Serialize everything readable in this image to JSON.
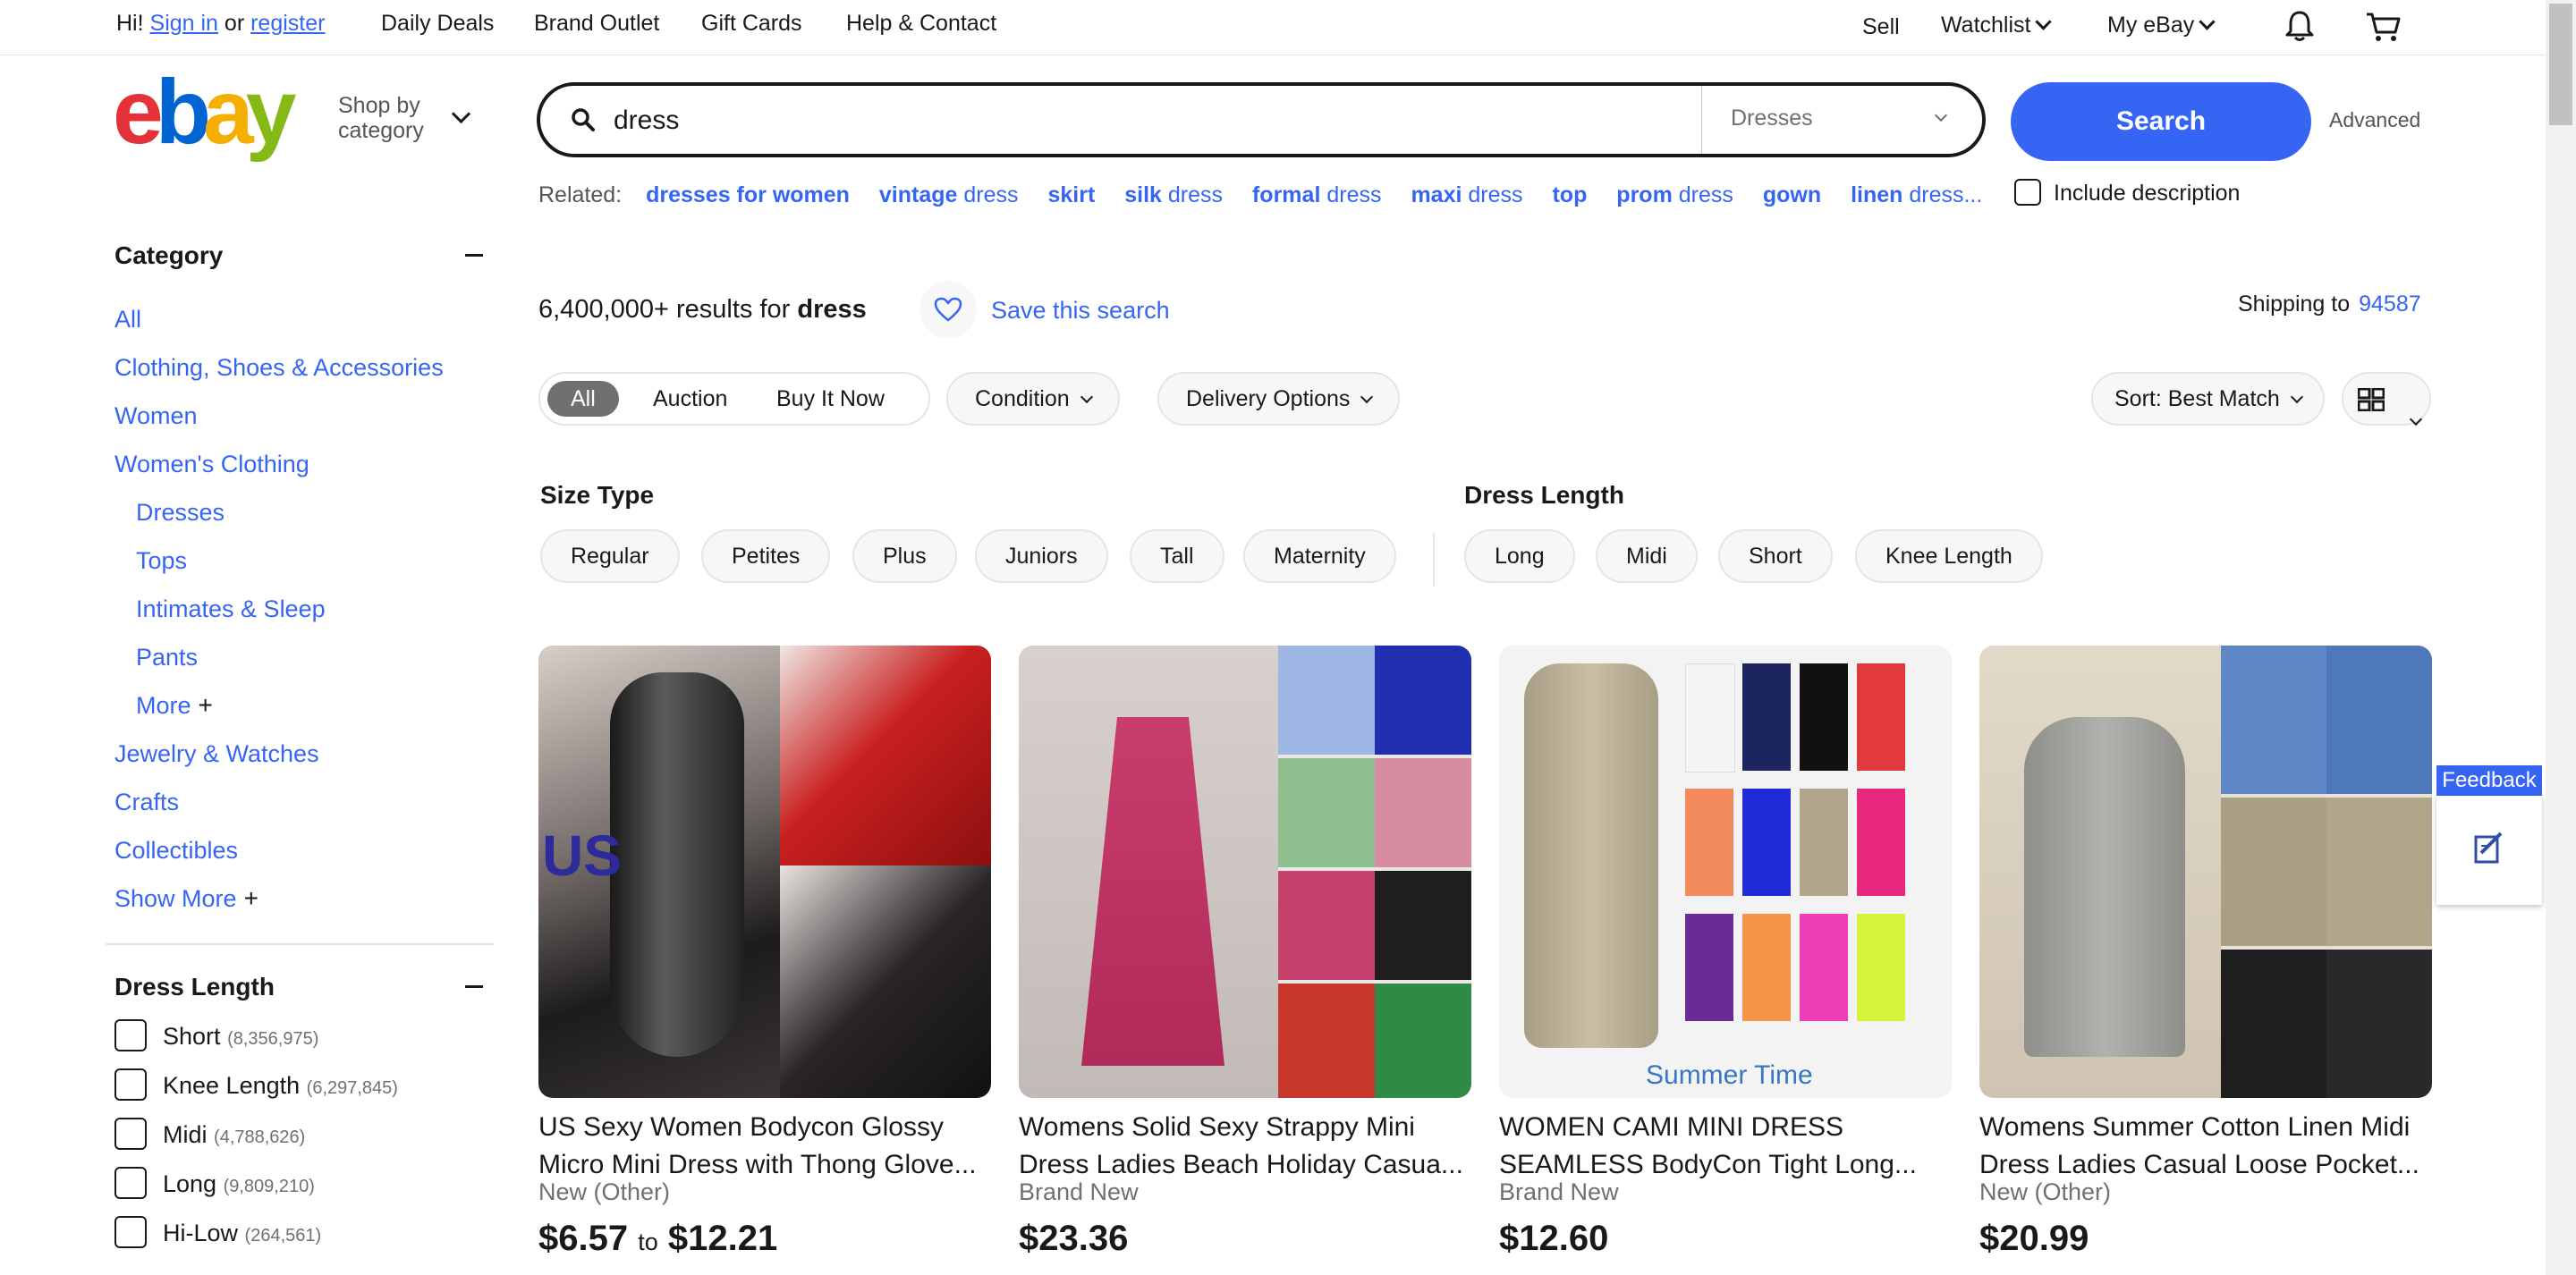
{
  "topbar": {
    "greeting": "Hi!",
    "sign_in": "Sign in",
    "or": "or",
    "register": "register",
    "nav": [
      "Daily Deals",
      "Brand Outlet",
      "Gift Cards",
      "Help & Contact"
    ],
    "sell": "Sell",
    "watchlist": "Watchlist",
    "my_ebay": "My eBay"
  },
  "header": {
    "logo_letters": [
      "e",
      "b",
      "a",
      "y"
    ],
    "logo_colors": [
      "#e53238",
      "#0064d2",
      "#f5af02",
      "#86b817"
    ],
    "shop_by_line1": "Shop by",
    "shop_by_line2": "category",
    "search_value": "dress",
    "category_select": "Dresses",
    "search_button": "Search",
    "advanced": "Advanced"
  },
  "related": {
    "label": "Related:",
    "items": [
      {
        "bold": "dresses for women",
        "rest": ""
      },
      {
        "bold": "vintage",
        "rest": " dress"
      },
      {
        "bold": "skirt",
        "rest": ""
      },
      {
        "bold": "silk",
        "rest": " dress"
      },
      {
        "bold": "formal",
        "rest": " dress"
      },
      {
        "bold": "maxi",
        "rest": " dress"
      },
      {
        "bold": "top",
        "rest": ""
      },
      {
        "bold": "prom",
        "rest": " dress"
      },
      {
        "bold": "gown",
        "rest": ""
      },
      {
        "bold": "linen",
        "rest": " dress..."
      }
    ],
    "include_description": "Include description"
  },
  "sidebar": {
    "category_heading": "Category",
    "categories": [
      {
        "label": "All",
        "indent": false
      },
      {
        "label": "Clothing, Shoes & Accessories",
        "indent": false
      },
      {
        "label": "Women",
        "indent": false
      },
      {
        "label": "Women's Clothing",
        "indent": false
      },
      {
        "label": "Dresses",
        "indent": true
      },
      {
        "label": "Tops",
        "indent": true
      },
      {
        "label": "Intimates & Sleep",
        "indent": true
      },
      {
        "label": "Pants",
        "indent": true
      },
      {
        "label": "More",
        "indent": true,
        "plus": true
      },
      {
        "label": "Jewelry & Watches",
        "indent": false
      },
      {
        "label": "Crafts",
        "indent": false
      },
      {
        "label": "Collectibles",
        "indent": false
      },
      {
        "label": "Show More",
        "indent": false,
        "plus": true
      }
    ],
    "dress_length_heading": "Dress Length",
    "dress_lengths": [
      {
        "label": "Short",
        "count": "(8,356,975)"
      },
      {
        "label": "Knee Length",
        "count": "(6,297,845)"
      },
      {
        "label": "Midi",
        "count": "(4,788,626)"
      },
      {
        "label": "Long",
        "count": "(9,809,210)"
      },
      {
        "label": "Hi-Low",
        "count": "(264,561)"
      }
    ]
  },
  "results": {
    "count": "6,400,000+",
    "results_for": "results for",
    "query": "dress",
    "save_search": "Save this search",
    "shipping_to": "Shipping to",
    "zip": "94587"
  },
  "filters": {
    "formats": [
      "All",
      "Auction",
      "Buy It Now"
    ],
    "condition": "Condition",
    "delivery": "Delivery Options",
    "sort": "Sort: Best Match"
  },
  "size_type": {
    "heading": "Size Type",
    "chips": [
      "Regular",
      "Petites",
      "Plus",
      "Juniors",
      "Tall",
      "Maternity"
    ]
  },
  "dress_length_chips": {
    "heading": "Dress Length",
    "chips": [
      "Long",
      "Midi",
      "Short",
      "Knee Length"
    ]
  },
  "products": [
    {
      "title": "US Sexy Women Bodycon Glossy Micro Mini Dress with Thong Glove...",
      "condition": "New (Other)",
      "price_low": "$6.57",
      "price_to": "to",
      "price_high": "$12.21",
      "img_text": "US"
    },
    {
      "title": "Womens Solid Sexy Strappy Mini Dress Ladies Beach Holiday Casua...",
      "condition": "Brand New",
      "price_low": "$23.36",
      "price_to": "",
      "price_high": "",
      "img_text": ""
    },
    {
      "title": "WOMEN CAMI MINI DRESS SEAMLESS BodyCon Tight Long...",
      "condition": "Brand New",
      "price_low": "$12.60",
      "price_to": "",
      "price_high": "",
      "img_text": "Summer Time"
    },
    {
      "title": "Womens Summer Cotton Linen Midi Dress Ladies Casual Loose Pocket...",
      "condition": "New (Other)",
      "price_low": "$20.99",
      "price_to": "",
      "price_high": "",
      "img_text": ""
    }
  ],
  "feedback": "Feedback",
  "icons": [
    "search-icon",
    "bell-icon",
    "cart-icon",
    "heart-icon",
    "grid-view-icon",
    "feedback-edit-icon"
  ]
}
